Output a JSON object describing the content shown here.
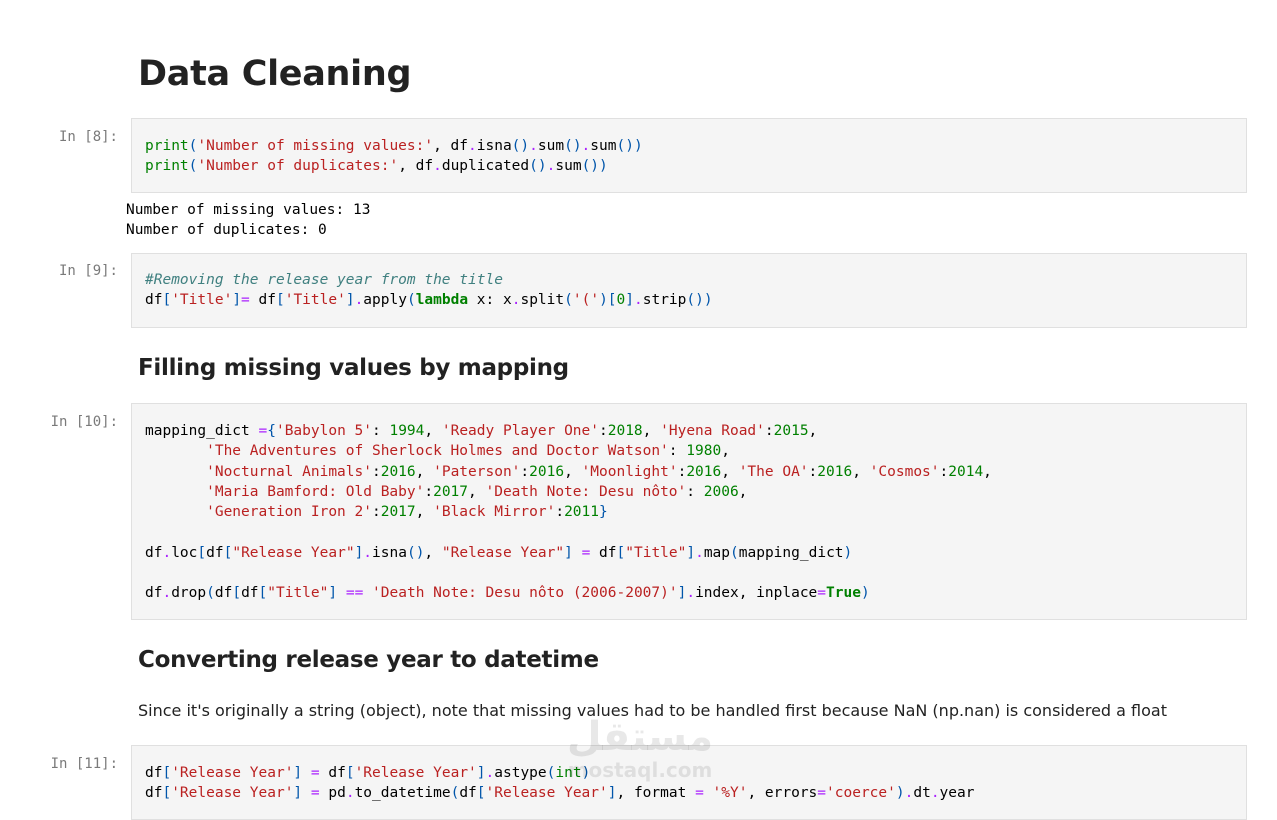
{
  "heading_main": "Data Cleaning",
  "cells": [
    {
      "prompt": "In [8]:",
      "lines": [
        "print('Number of missing values:', df.isna().sum().sum())",
        "print('Number of duplicates:', df.duplicated().sum())"
      ],
      "output": [
        "Number of missing values: 13",
        "Number of duplicates: 0"
      ]
    },
    {
      "prompt": "In [9]:",
      "lines": [
        "#Removing the release year from the title",
        "df['Title']= df['Title'].apply(lambda x: x.split('(')[0].strip())"
      ]
    },
    {
      "prompt": "In [10]:",
      "lines": [
        "mapping_dict ={'Babylon 5': 1994, 'Ready Player One':2018, 'Hyena Road':2015,",
        "       'The Adventures of Sherlock Holmes and Doctor Watson': 1980,",
        "       'Nocturnal Animals':2016, 'Paterson':2016, 'Moonlight':2016, 'The OA':2016, 'Cosmos':2014,",
        "       'Maria Bamford: Old Baby':2017, 'Death Note: Desu nôto': 2006,",
        "       'Generation Iron 2':2017, 'Black Mirror':2011}",
        "",
        "df.loc[df[\"Release Year\"].isna(), \"Release Year\"] = df[\"Title\"].map(mapping_dict)",
        "",
        "df.drop(df[df[\"Title\"] == 'Death Note: Desu nôto (2006-2007)'].index, inplace=True)"
      ]
    },
    {
      "prompt": "In [11]:",
      "lines": [
        "df['Release Year'] = df['Release Year'].astype(int)",
        "df['Release Year'] = pd.to_datetime(df['Release Year'], format = '%Y', errors='coerce').dt.year"
      ]
    }
  ],
  "heading_filling": "Filling missing values by mapping",
  "heading_converting": "Converting release year to datetime",
  "paragraph_converting": "Since it's originally a string (object), note that missing values had to be handled first because NaN (np.nan) is considered a float",
  "watermark": {
    "arabic": "مستقل",
    "latin": "mostaql.com"
  },
  "syntax_colors": {
    "string": "#ba2121",
    "number": "#008000",
    "keyword": "#008000",
    "operator": "#aa22ff",
    "comment": "#408080"
  }
}
